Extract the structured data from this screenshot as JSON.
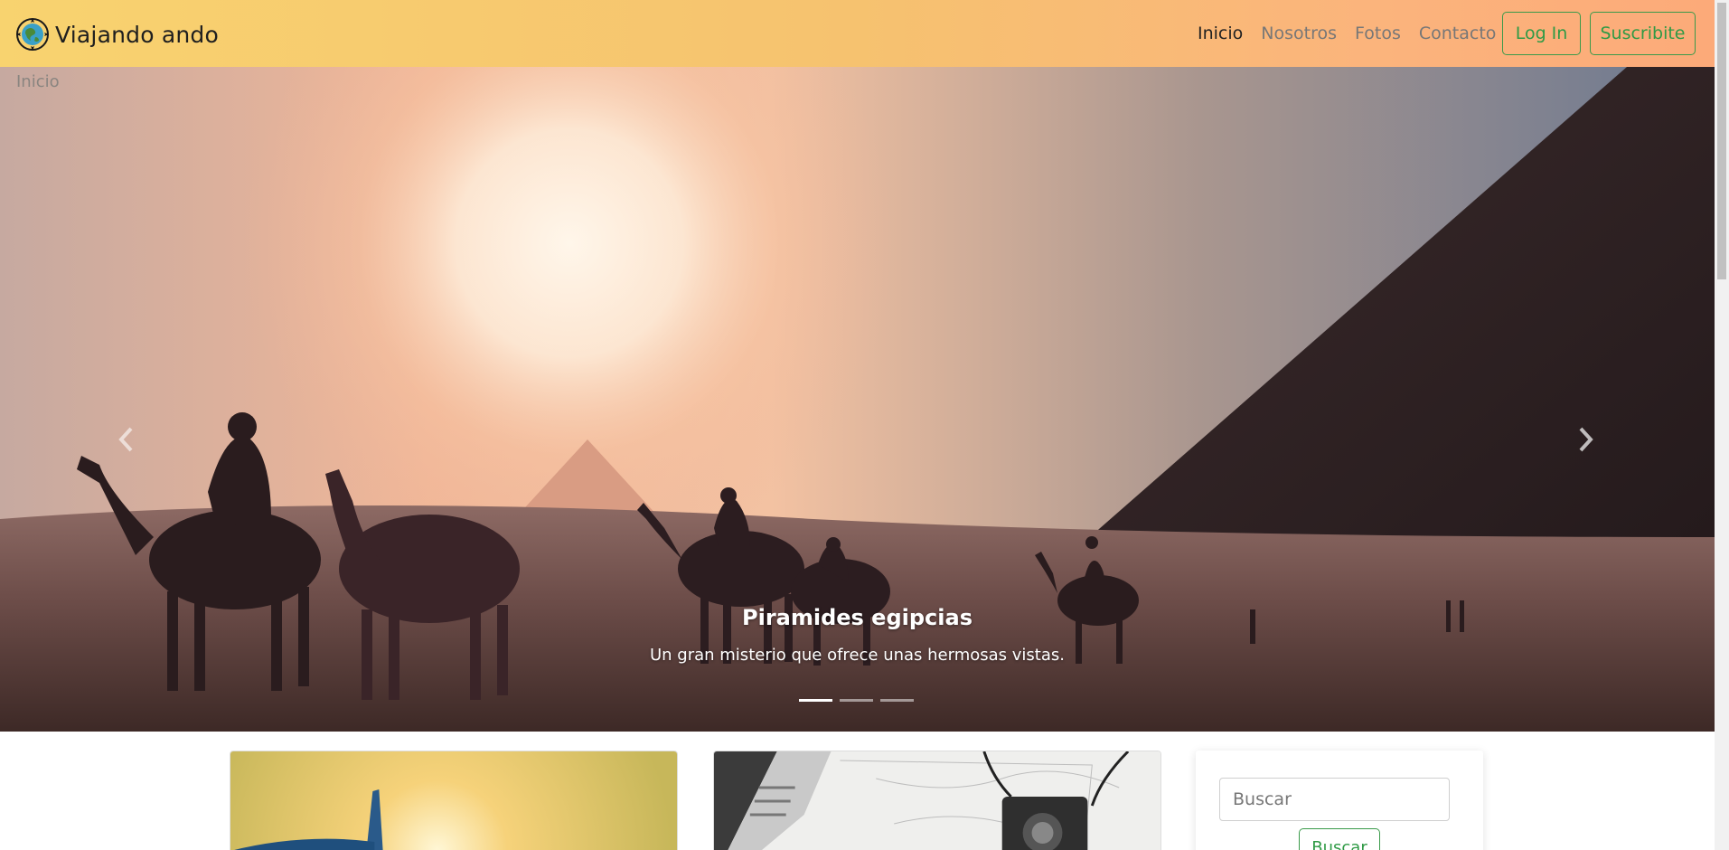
{
  "navbar": {
    "brand": "Viajando ando",
    "links": [
      {
        "label": "Inicio"
      },
      {
        "label": "Nosotros"
      },
      {
        "label": "Fotos"
      },
      {
        "label": "Contacto"
      }
    ],
    "login_label": "Log In",
    "subscribe_label": "Suscribite"
  },
  "breadcrumb": "Inicio",
  "carousel": {
    "slide_title": "Piramides egipcias",
    "slide_text": "Un gran misterio que ofrece unas hermosas vistas.",
    "active_slide": 1,
    "slide_count": 3
  },
  "sidebar": {
    "search_placeholder": "Buscar",
    "search_button": "Buscar"
  },
  "colors": {
    "accent_green": "#2f9a45",
    "navbar_left": "#f8d36f",
    "navbar_right": "#fcaa79"
  }
}
